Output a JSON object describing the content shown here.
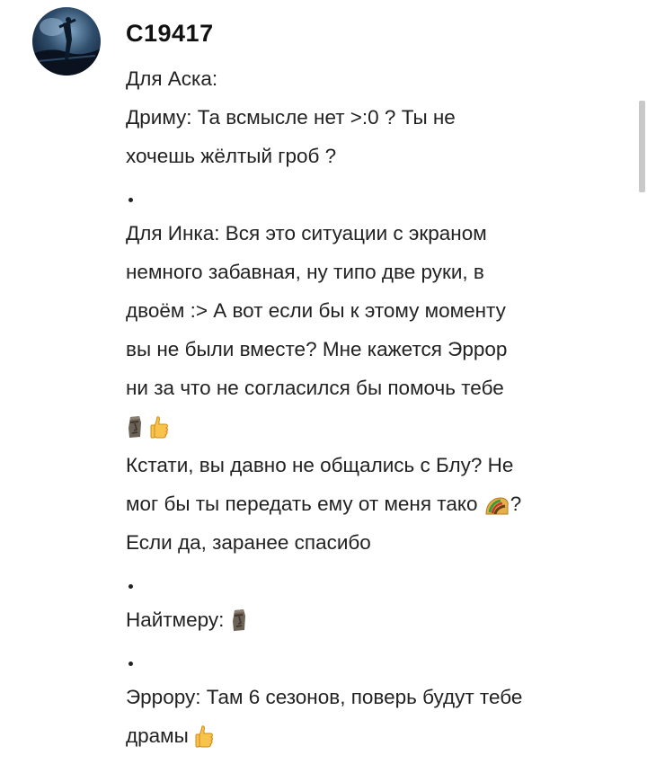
{
  "post": {
    "username": "C19417",
    "avatar_icon": "avatar-icon",
    "lines": {
      "l1": "Для Аска:",
      "l2": "Дриму: Та всмысле нет >:0 ? Ты не",
      "l3": "хочешь жёлтый гроб ?",
      "l5": "Для Инка: Вся это ситуации с экраном",
      "l6": "немного забавная, ну типо две руки, в",
      "l7": "двоём :> А вот если бы к этому моменту",
      "l8": "вы не были вместе? Мне кажется Эррор",
      "l9": "ни за что не согласился бы помочь тебе",
      "l11": "Кстати, вы давно не общались с Блу? Не",
      "l12a": "мог бы ты передать ему от меня тако",
      "l12b": "?",
      "l13": "Если да, заранее спасибо",
      "l15": "Найтмеру:",
      "l17": "Эррору: Там 6 сезонов, поверь будут тебе",
      "l18": "драмы"
    },
    "emojis": {
      "moai": "moai-emoji",
      "thumbs_up": "thumbs-up-emoji",
      "taco": "taco-emoji"
    }
  },
  "colors": {
    "text": "#222222",
    "scrollbar": "#c9c9c9"
  }
}
